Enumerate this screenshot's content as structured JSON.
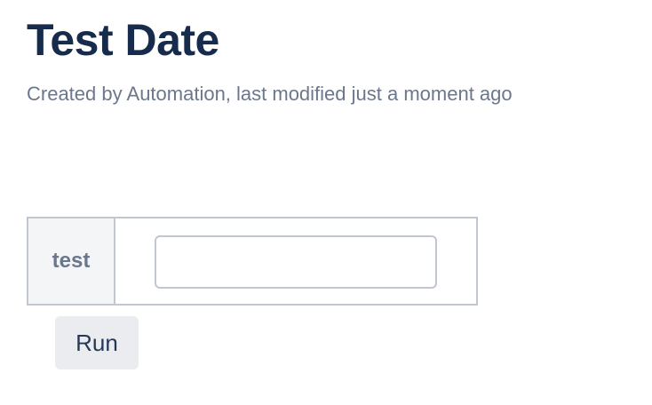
{
  "page": {
    "title": "Test Date",
    "byline": "Created by Automation, last modified just a moment ago"
  },
  "parameters": {
    "rows": [
      {
        "label": "test",
        "value": "",
        "placeholder": ""
      }
    ]
  },
  "actions": {
    "run_label": "Run"
  },
  "colors": {
    "title": "#172b4d",
    "byline": "#6b778c",
    "table_border": "#c1c7d0",
    "label_cell_bg": "#f4f5f7",
    "button_bg": "#ebecf0",
    "button_text": "#253858"
  }
}
